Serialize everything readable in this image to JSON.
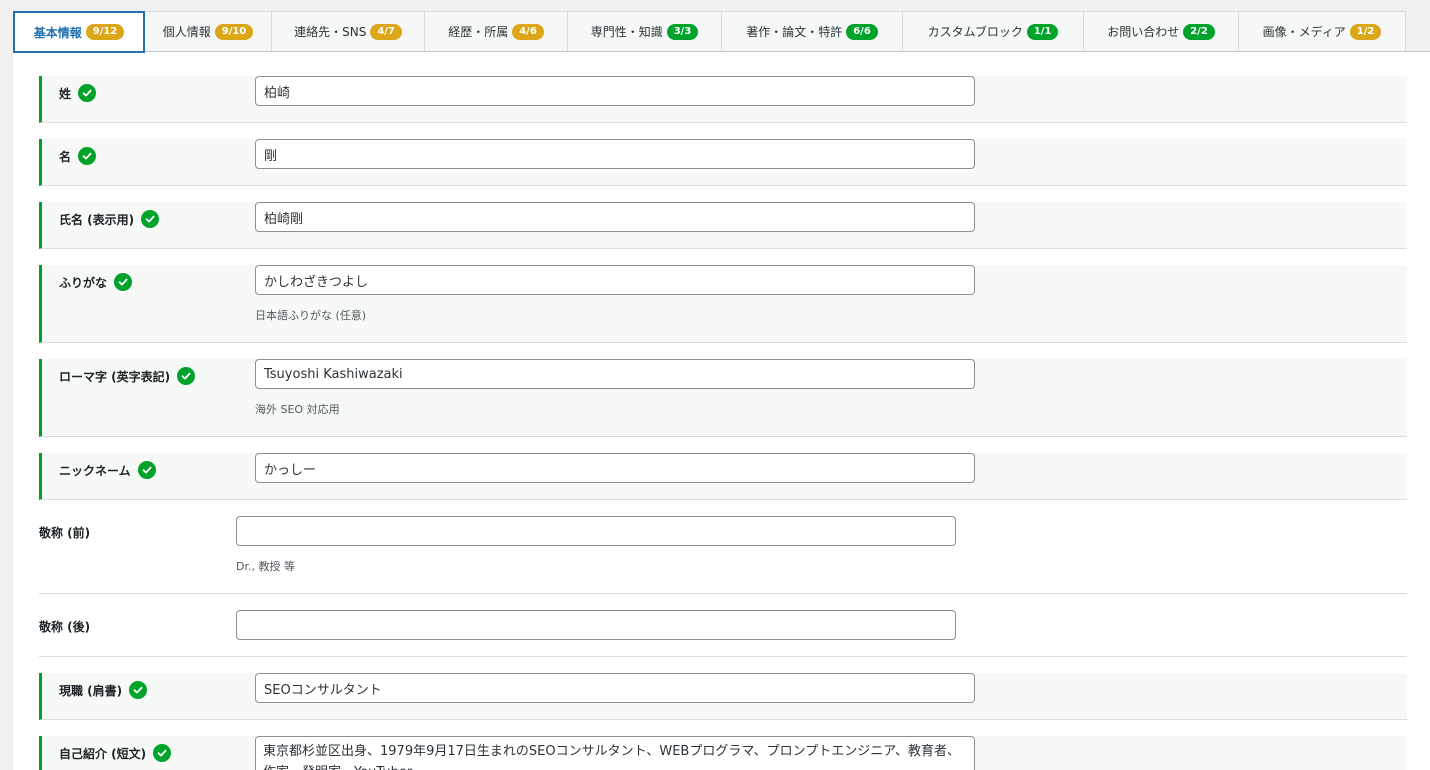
{
  "tabs": [
    {
      "label": "基本情報",
      "badge": "9/12",
      "badge_color": "orange",
      "active": true
    },
    {
      "label": "個人情報",
      "badge": "9/10",
      "badge_color": "orange"
    },
    {
      "label": "連絡先・SNS",
      "badge": "4/7",
      "badge_color": "orange"
    },
    {
      "label": "経歴・所属",
      "badge": "4/6",
      "badge_color": "orange"
    },
    {
      "label": "専門性・知識",
      "badge": "3/3",
      "badge_color": "green"
    },
    {
      "label": "著作・論文・特許",
      "badge": "6/6",
      "badge_color": "green"
    },
    {
      "label": "カスタムブロック",
      "badge": "1/1",
      "badge_color": "green"
    },
    {
      "label": "お問い合わせ",
      "badge": "2/2",
      "badge_color": "green"
    },
    {
      "label": "画像・メディア",
      "badge": "1/2",
      "badge_color": "orange"
    }
  ],
  "fields": {
    "last_name": {
      "label": "姓",
      "value": "柏崎",
      "completed": true
    },
    "first_name": {
      "label": "名",
      "value": "剛",
      "completed": true
    },
    "display_name": {
      "label": "氏名 (表示用)",
      "value": "柏崎剛",
      "completed": true
    },
    "furigana": {
      "label": "ふりがな",
      "value": "かしわざきつよし",
      "help": "日本語ふりがな (任意)",
      "completed": true
    },
    "romaji": {
      "label": "ローマ字 (英字表記)",
      "value": "Tsuyoshi Kashiwazaki",
      "help": "海外 SEO 対応用",
      "completed": true
    },
    "nickname": {
      "label": "ニックネーム",
      "value": "かっしー",
      "completed": true
    },
    "honorific_prefix": {
      "label": "敬称 (前)",
      "value": "",
      "help": "Dr., 教授 等",
      "completed": false
    },
    "honorific_suffix": {
      "label": "敬称 (後)",
      "value": "",
      "completed": false
    },
    "job_title": {
      "label": "現職 (肩書)",
      "value": "SEOコンサルタント",
      "completed": true
    },
    "bio_short": {
      "label": "自己紹介 (短文)",
      "value": "東京都杉並区出身、1979年9月17日生まれのSEOコンサルタント、WEBプログラマ、プロンプトエンジニア、教育者、作家、発明家、YouTuber",
      "completed": true
    }
  },
  "colors": {
    "accent": "#2271b1",
    "badge_orange": "#dba617",
    "badge_green": "#00a32a",
    "check_green": "#00a32a"
  }
}
